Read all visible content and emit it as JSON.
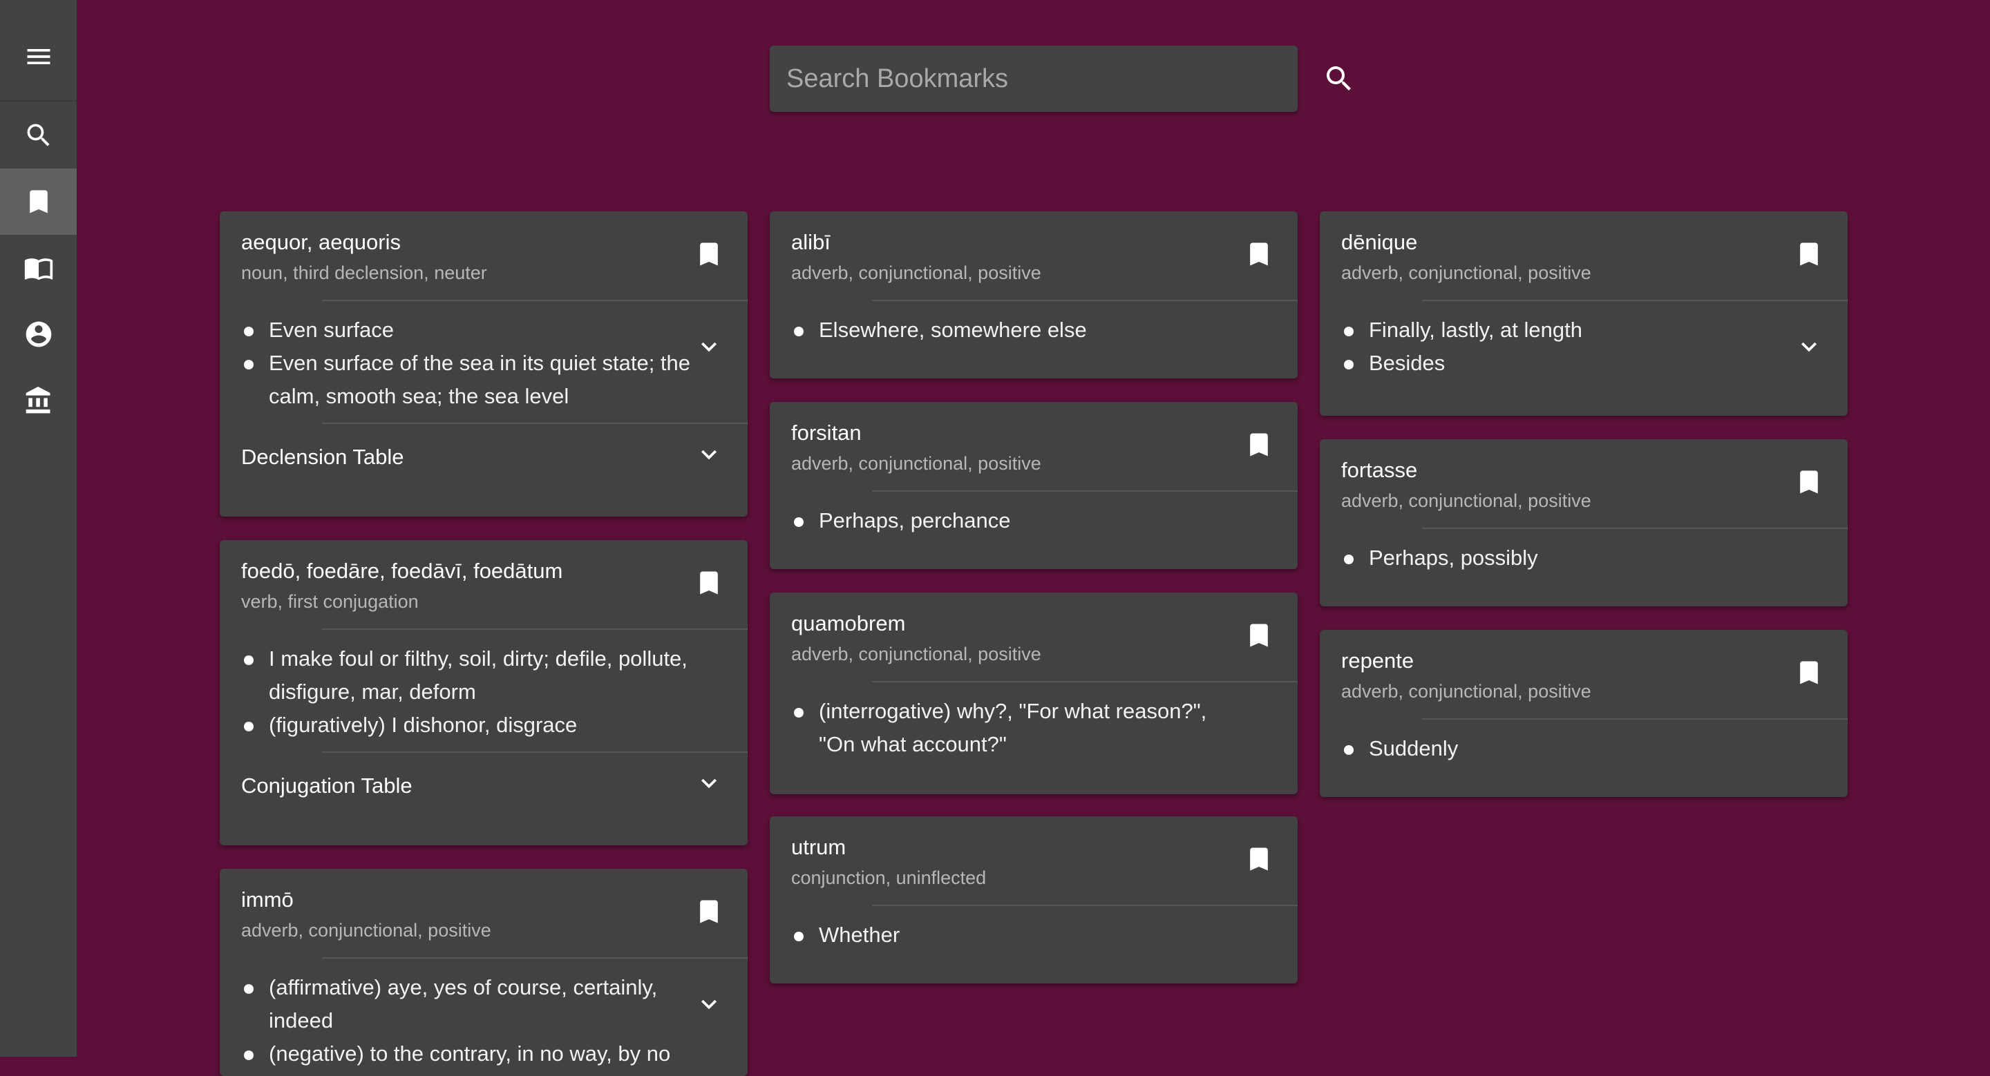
{
  "sidebar": {
    "items": [
      {
        "name": "menu",
        "icon": "menu-icon"
      },
      {
        "name": "search",
        "icon": "search-icon"
      },
      {
        "name": "bookmarks",
        "icon": "bookmark-icon",
        "active": true
      },
      {
        "name": "library",
        "icon": "book-open-icon"
      },
      {
        "name": "account",
        "icon": "account-circle-icon"
      },
      {
        "name": "institution",
        "icon": "institution-icon"
      }
    ]
  },
  "search": {
    "placeholder": "Search Bookmarks",
    "value": ""
  },
  "colors": {
    "background": "#5c1039",
    "card": "#424242",
    "sidebar": "#434343",
    "active": "#616161"
  },
  "cards": {
    "aequor": {
      "title": "aequor, aequoris",
      "subtitle": "noun, third declension, neuter",
      "definitions": [
        "Even surface",
        "Even surface of the sea in its quiet state; the calm, smooth sea; the sea level"
      ],
      "table_label": "Declension Table"
    },
    "foedo": {
      "title": "foedō, foedāre, foedāvī, foedātum",
      "subtitle": "verb, first conjugation",
      "definitions": [
        "I make foul or filthy, soil, dirty; defile, pollute, disfigure, mar, deform",
        "(figuratively) I dishonor, disgrace"
      ],
      "table_label": "Conjugation Table"
    },
    "immo": {
      "title": "immō",
      "subtitle": "adverb, conjunctional, positive",
      "definitions": [
        "(affirmative) aye, yes of course, certainly, indeed",
        "(negative) to the contrary, in no way, by no means"
      ]
    },
    "alibi": {
      "title": "alibī",
      "subtitle": "adverb, conjunctional, positive",
      "definitions": [
        "Elsewhere, somewhere else"
      ]
    },
    "forsitan": {
      "title": "forsitan",
      "subtitle": "adverb, conjunctional, positive",
      "definitions": [
        "Perhaps, perchance"
      ]
    },
    "quamobrem": {
      "title": "quamobrem",
      "subtitle": "adverb, conjunctional, positive",
      "definitions": [
        "(interrogative) why?, \"For what reason?\", \"On what account?\""
      ]
    },
    "utrum": {
      "title": "utrum",
      "subtitle": "conjunction, uninflected",
      "definitions": [
        "Whether"
      ]
    },
    "denique": {
      "title": "dēnique",
      "subtitle": "adverb, conjunctional, positive",
      "definitions": [
        "Finally, lastly, at length",
        "Besides"
      ]
    },
    "fortasse": {
      "title": "fortasse",
      "subtitle": "adverb, conjunctional, positive",
      "definitions": [
        "Perhaps, possibly"
      ]
    },
    "repente": {
      "title": "repente",
      "subtitle": "adverb, conjunctional, positive",
      "definitions": [
        "Suddenly"
      ]
    }
  }
}
